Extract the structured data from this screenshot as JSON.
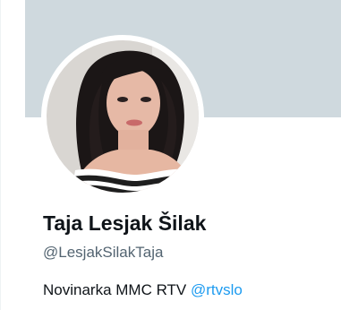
{
  "profile": {
    "display_name": "Taja Lesjak Šilak",
    "handle": "@LesjakSilakTaja",
    "bio": {
      "text": "Novinarka MMC RTV ",
      "mention": "@rtvslo"
    }
  },
  "colors": {
    "banner": "#cfd9de",
    "name_text": "#0f1419",
    "handle_text": "#536471",
    "link": "#1d9bf0"
  }
}
